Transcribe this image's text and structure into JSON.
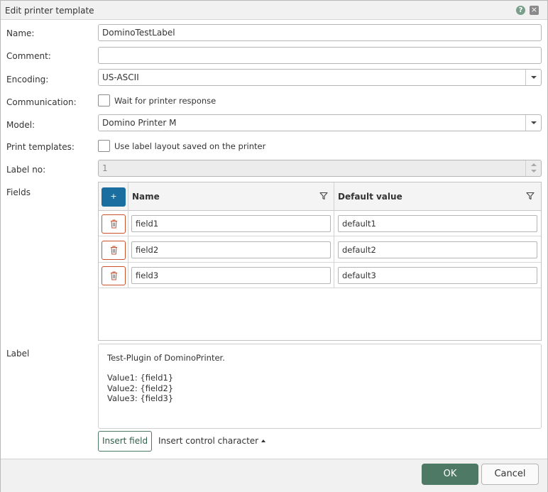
{
  "dialog": {
    "title": "Edit printer template",
    "help_icon": "?",
    "close_icon": "×"
  },
  "form": {
    "name_label": "Name:",
    "name_value": "DominoTestLabel",
    "comment_label": "Comment:",
    "comment_value": "",
    "encoding_label": "Encoding:",
    "encoding_value": "US-ASCII",
    "communication_label": "Communication:",
    "communication_checkbox_label": "Wait for printer response",
    "communication_checked": false,
    "model_label": "Model:",
    "model_value": "Domino Printer M",
    "print_templates_label": "Print templates:",
    "print_templates_checkbox_label": "Use label layout saved on the printer",
    "print_templates_checked": false,
    "label_no_label": "Label no:",
    "label_no_value": "1",
    "fields_label": "Fields",
    "label_label": "Label"
  },
  "fields_grid": {
    "add_icon": "+",
    "columns": [
      "Name",
      "Default value"
    ],
    "rows": [
      {
        "name": "field1",
        "default": "default1"
      },
      {
        "name": "field2",
        "default": "default2"
      },
      {
        "name": "field3",
        "default": "default3"
      }
    ]
  },
  "label_text": "Test-Plugin of DominoPrinter.\n\nValue1: {field1}\nValue2: {field2}\nValue3: {field3}",
  "actions": {
    "insert_field": "Insert field",
    "insert_control_character": "Insert control character",
    "ok": "OK",
    "cancel": "Cancel"
  },
  "colors": {
    "primary_green": "#4e7a65",
    "add_blue": "#1a6fa0",
    "delete_red": "#c9522c"
  }
}
